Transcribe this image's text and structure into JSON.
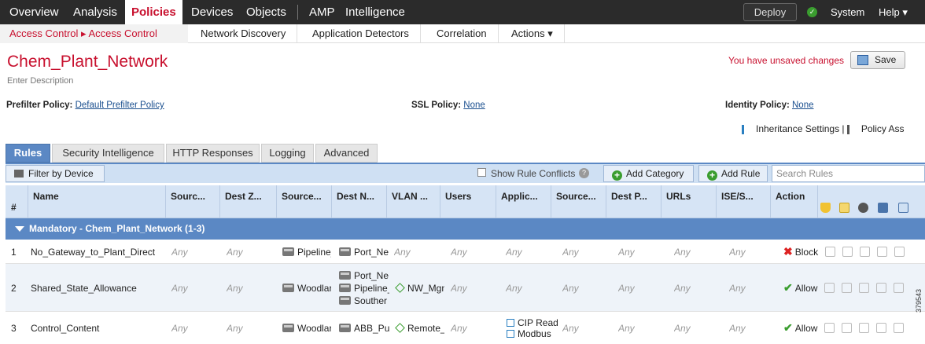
{
  "nav": {
    "items": [
      "Overview",
      "Analysis",
      "Policies",
      "Devices",
      "Objects",
      "AMP",
      "Intelligence"
    ],
    "deploy": "Deploy",
    "system": "System",
    "help": "Help ▾"
  },
  "subnav": {
    "breadcrumb": "Access Control ▸ Access Control",
    "links": [
      "Network Discovery",
      "Application Detectors",
      "Correlation",
      "Actions ▾"
    ]
  },
  "page": {
    "title": "Chem_Plant_Network",
    "description_placeholder": "Enter Description",
    "unsaved": "You have unsaved changes",
    "save": "Save",
    "prefilter_label": "Prefilter Policy:",
    "prefilter_value": "Default Prefilter Policy",
    "ssl_label": "SSL Policy:",
    "ssl_value": "None",
    "identity_label": "Identity Policy:",
    "identity_value": "None",
    "inheritance": "Inheritance Settings",
    "policy_assign": "Policy Ass"
  },
  "tabs": [
    "Rules",
    "Security Intelligence",
    "HTTP Responses",
    "Logging",
    "Advanced"
  ],
  "toolbar": {
    "filter": "Filter by Device",
    "show_conflicts": "Show Rule Conflicts",
    "add_category": "Add Category",
    "add_rule": "Add Rule",
    "search_placeholder": "Search Rules"
  },
  "columns": [
    "#",
    "Name",
    "Sourc...",
    "Dest Z...",
    "Source...",
    "Dest N...",
    "VLAN ...",
    "Users",
    "Applic...",
    "Source...",
    "Dest P...",
    "URLs",
    "ISE/S...",
    "Action"
  ],
  "category": "Mandatory - Chem_Plant_Network (1-3)",
  "rows": [
    {
      "num": "1",
      "name": "No_Gateway_to_Plant_Direct",
      "src_zone": "Any",
      "dst_zone": "Any",
      "src_net": "Pipeline_",
      "dst_net": [
        "Port_Ne"
      ],
      "vlan": "Any",
      "users": "Any",
      "apps": [
        "Any"
      ],
      "src_port": "Any",
      "dst_port": "Any",
      "urls": "Any",
      "ise": "Any",
      "action": "Block"
    },
    {
      "num": "2",
      "name": "Shared_State_Allowance",
      "src_zone": "Any",
      "dst_zone": "Any",
      "src_net": "Woodlar",
      "dst_net": [
        "Port_Ne",
        "Pipeline_",
        "Souther"
      ],
      "vlan": "NW_Mgn",
      "users": "Any",
      "apps": [
        "Any"
      ],
      "src_port": "Any",
      "dst_port": "Any",
      "urls": "Any",
      "ise": "Any",
      "action": "Allow"
    },
    {
      "num": "3",
      "name": "Control_Content",
      "src_zone": "Any",
      "dst_zone": "Any",
      "src_net": "Woodlar",
      "dst_net": [
        "ABB_Pu"
      ],
      "vlan": "Remote_",
      "users": "Any",
      "apps": [
        "CIP Read",
        "Modbus"
      ],
      "src_port": "Any",
      "dst_port": "Any",
      "urls": "Any",
      "ise": "Any",
      "action": "Allow"
    }
  ],
  "figure_id": "379543"
}
